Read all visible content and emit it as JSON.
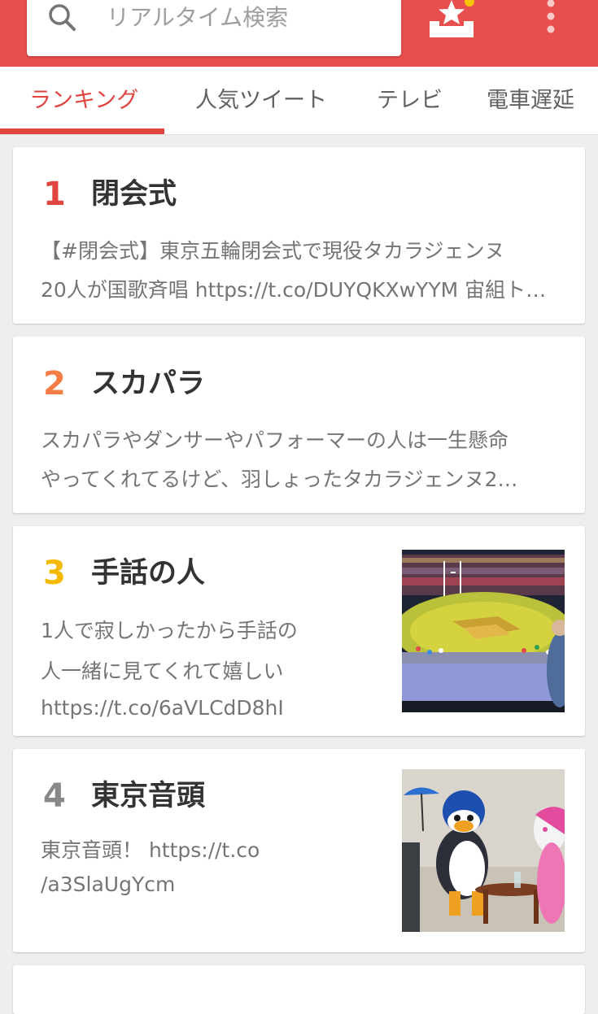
{
  "header": {
    "search_placeholder": "リアルタイム検索",
    "brand_color": "#e84e4e",
    "icons": [
      "search-icon",
      "favorites-star-icon",
      "more-vert-icon"
    ]
  },
  "tabs": [
    {
      "label": "ランキング",
      "active": true
    },
    {
      "label": "人気ツイート",
      "active": false
    },
    {
      "label": "テレビ",
      "active": false
    },
    {
      "label": "電車遅延",
      "active": false
    }
  ],
  "ranking": [
    {
      "rank": "1",
      "rank_color": "#e0453f",
      "title": "閉会式",
      "lines": [
        "【#閉会式】東京五輪閉会式で現役タカラジェンヌ",
        "20人が国歌斉唱 https://t.co/DUYQKXwYYM 宙組ト…"
      ]
    },
    {
      "rank": "2",
      "rank_color": "#f47c45",
      "title": "スカパラ",
      "lines": [
        "スカパラやダンサーやパフォーマーの人は一生懸命",
        "やってくれてるけど、羽しょったタカラジェンヌ2…"
      ]
    },
    {
      "rank": "3",
      "rank_color": "#f5b800",
      "title": "手話の人",
      "lines": [
        "1人で寂しかったから手話の",
        "人一緒に見てくれて嬉しい",
        "https://t.co/6aVLCdD8hI"
      ],
      "thumbnail": "stadium-ceremony-photo"
    },
    {
      "rank": "4",
      "rank_color": "#888888",
      "title": "東京音頭",
      "lines": [
        "東京音頭！ https://t.co",
        "/a3SlaUgYcm"
      ],
      "thumbnail": "mascots-photo"
    }
  ]
}
